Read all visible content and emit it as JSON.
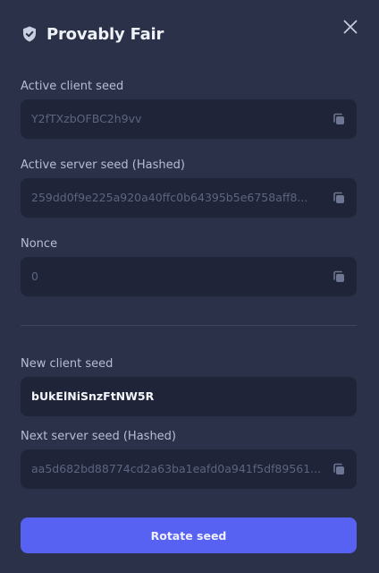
{
  "header": {
    "title": "Provably Fair",
    "shield_icon": "shield-check-icon",
    "close_icon": "close-icon"
  },
  "fields": {
    "active_client_seed": {
      "label": "Active client seed",
      "value": "Y2fTXzbOFBC2h9vv"
    },
    "active_server_seed": {
      "label": "Active server seed (Hashed)",
      "value": "259dd0f9e225a920a40ffc0b64395b5e6758aff8..."
    },
    "nonce": {
      "label": "Nonce",
      "value": "0"
    },
    "new_client_seed": {
      "label": "New client seed",
      "value": "bUkElNiSnzFtNW5R"
    },
    "next_server_seed": {
      "label": "Next server seed (Hashed)",
      "value": "aa5d682bd88774cd2a63ba1eafd0a941f5df89561..."
    }
  },
  "actions": {
    "rotate_label": "Rotate seed"
  },
  "colors": {
    "background": "#2a3149",
    "field": "#1f2438",
    "accent": "#5761f2"
  }
}
